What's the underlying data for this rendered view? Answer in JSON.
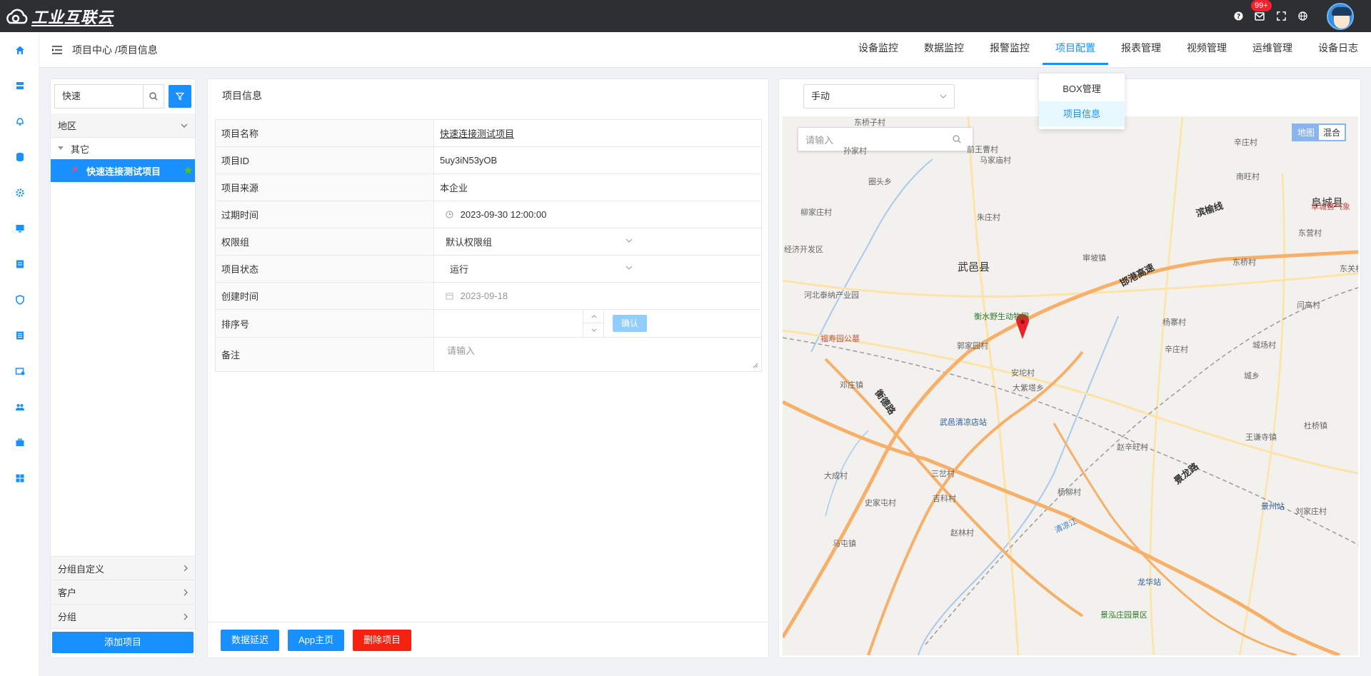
{
  "brand": {
    "logo_text": "工业互联云"
  },
  "topbar": {
    "badge": "99+"
  },
  "header": {
    "breadcrumb": "项目中心 /项目信息",
    "nav": [
      "设备监控",
      "数据监控",
      "报警监控",
      "项目配置",
      "报表管理",
      "视频管理",
      "运维管理",
      "设备日志"
    ],
    "active_nav": "项目配置"
  },
  "dropdown": {
    "items": [
      "BOX管理",
      "项目信息"
    ],
    "selected": "项目信息"
  },
  "sidebar": {
    "search_value": "快速",
    "region_label": "地区",
    "node_other": "其它",
    "selected_project": "快速连接测试项目",
    "groups": [
      "分组自定义",
      "客户",
      "分组"
    ],
    "add_button": "添加项目"
  },
  "info": {
    "title": "项目信息",
    "rows": {
      "name_label": "项目名称",
      "name_value": "快速连接测试项目",
      "id_label": "项目ID",
      "id_value": "5uy3iN53yOB",
      "source_label": "项目来源",
      "source_value": "本企业",
      "expire_label": "过期时间",
      "expire_value": "2023-09-30 12:00:00",
      "perm_label": "权限组",
      "perm_value": "默认权限组",
      "status_label": "项目状态",
      "status_value": "运行",
      "created_label": "创建时间",
      "created_value": "2023-09-18",
      "order_label": "排序号",
      "order_value": "",
      "confirm": "确认",
      "note_label": "备注",
      "note_placeholder": "请输入"
    },
    "buttons": {
      "delay": "数据延迟",
      "app": "App主页",
      "delete": "删除项目"
    }
  },
  "map": {
    "mode": "手动",
    "search_placeholder": "请输入",
    "type_map": "地图",
    "type_hybrid": "混合",
    "labels": {
      "wuyi": "武邑县",
      "fucheng": "阜城县",
      "zoo": "衡水野生动物园",
      "binyu": "滨榆线",
      "handan": "邯港高速",
      "qingliang": "武邑清凉店站",
      "jinglong": "景龙路",
      "hengde": "衡德路",
      "jingfu": "景泓庄园景区",
      "longhua": "龙华站",
      "jingzhou": "景州站",
      "fushou": "福寿园公墓",
      "taina": "河北泰纳产业园",
      "kaifa": "经济开发区",
      "qingliangjiang": "清凉江",
      "dongqiaozi": "东桥子村",
      "sunjia": "孙家村",
      "qianwang": "前王曹村",
      "majiamiao": "马家庙村",
      "quanqiu": "圈头乡",
      "liujiazhuang": "柳家庄村",
      "zhuzhuang": "朱庄村",
      "shenpo": "审坡镇",
      "yangzhai": "杨寨村",
      "guojiayuan": "郭家园村",
      "anyan": "安坨村",
      "dazitai": "大紫塔乡",
      "dengzhuang": "邓庄镇",
      "sanmao": "三岔村",
      "daicheng": "大成村",
      "shijiatun": "史家屯村",
      "jike": "吉科村",
      "mashen": "马屯镇",
      "zhaolin": "赵林村",
      "yangliu": "杨柳村",
      "zhaoxin": "赵辛旺村",
      "wangqian": "王谦寺镇",
      "liujiazhuang2": "刘家庄村",
      "dongqiao": "东桥村",
      "nanwang": "南旺村",
      "xinzhuang": "辛庄村",
      "dongguan": "东关村",
      "xinzhuang2": "辛庄村",
      "shengfan": "城乡",
      "fucheng_weather": "阜城县气象",
      "yanwo": "闫高村",
      "chengzhuang": "城场村",
      "duqiao": "杜桥镇",
      "dongying": "东营村"
    }
  }
}
